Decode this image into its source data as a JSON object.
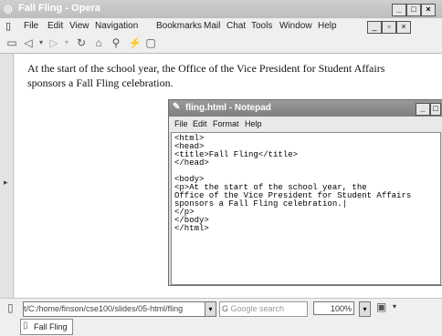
{
  "browser": {
    "title": "Fall Fling - Opera",
    "menus": [
      "File",
      "Edit",
      "View",
      "Navigation",
      "Bookmarks",
      "Mail",
      "Chat",
      "Tools",
      "Window",
      "Help"
    ],
    "page_text": "At the start of the school year, the Office of the Vice President for Student Affairs sponsors a Fall Fling celebration.",
    "address": "t/C:/home/finson/cse100/slides/05-html/fling",
    "search_placeholder": "Google search",
    "zoom": "100%",
    "tab_label": "Fall Fling",
    "window_buttons": [
      "_",
      "□",
      "×"
    ],
    "inner_buttons": [
      "_",
      "▫",
      "×"
    ]
  },
  "notepad": {
    "title": "fling.html - Notepad",
    "menus": [
      "File",
      "Edit",
      "Format",
      "Help"
    ],
    "lines": [
      "<html>",
      "<head>",
      "<title>Fall Fling</title>",
      "</head>",
      "",
      "<body>",
      "<p>At the start of the school year, the",
      "Office of the Vice President for Student Affairs",
      "sponsors a Fall Fling celebration.|",
      "</p>",
      "</body>",
      "</html>"
    ],
    "min_button": "_",
    "max_button": "□"
  }
}
